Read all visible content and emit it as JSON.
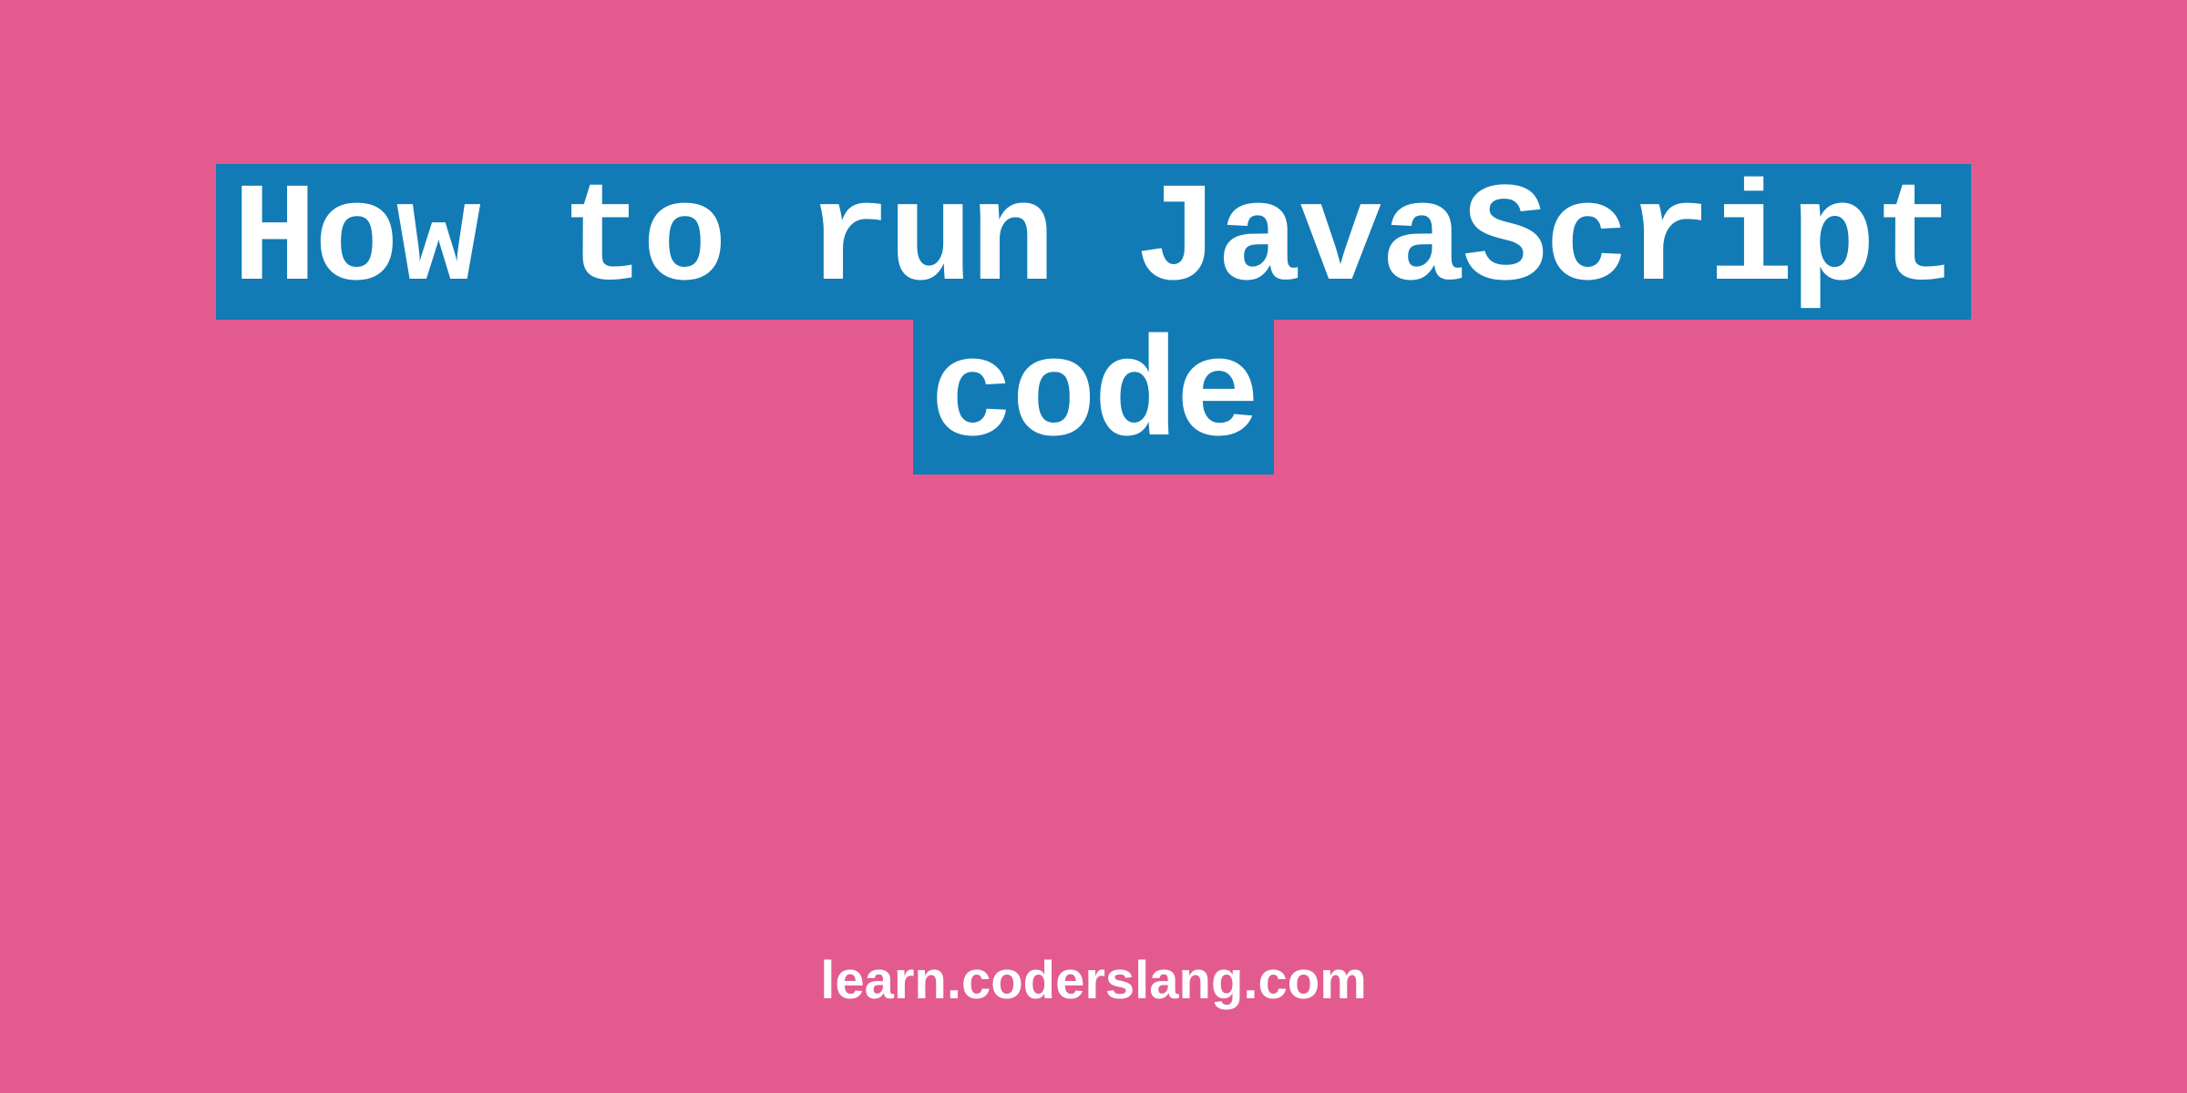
{
  "title": {
    "line1": "How to run JavaScript",
    "line2": "code"
  },
  "footer": "learn.coderslang.com",
  "colors": {
    "background": "#e35b8e",
    "highlight": "#127bb5",
    "text": "#ffffff"
  }
}
